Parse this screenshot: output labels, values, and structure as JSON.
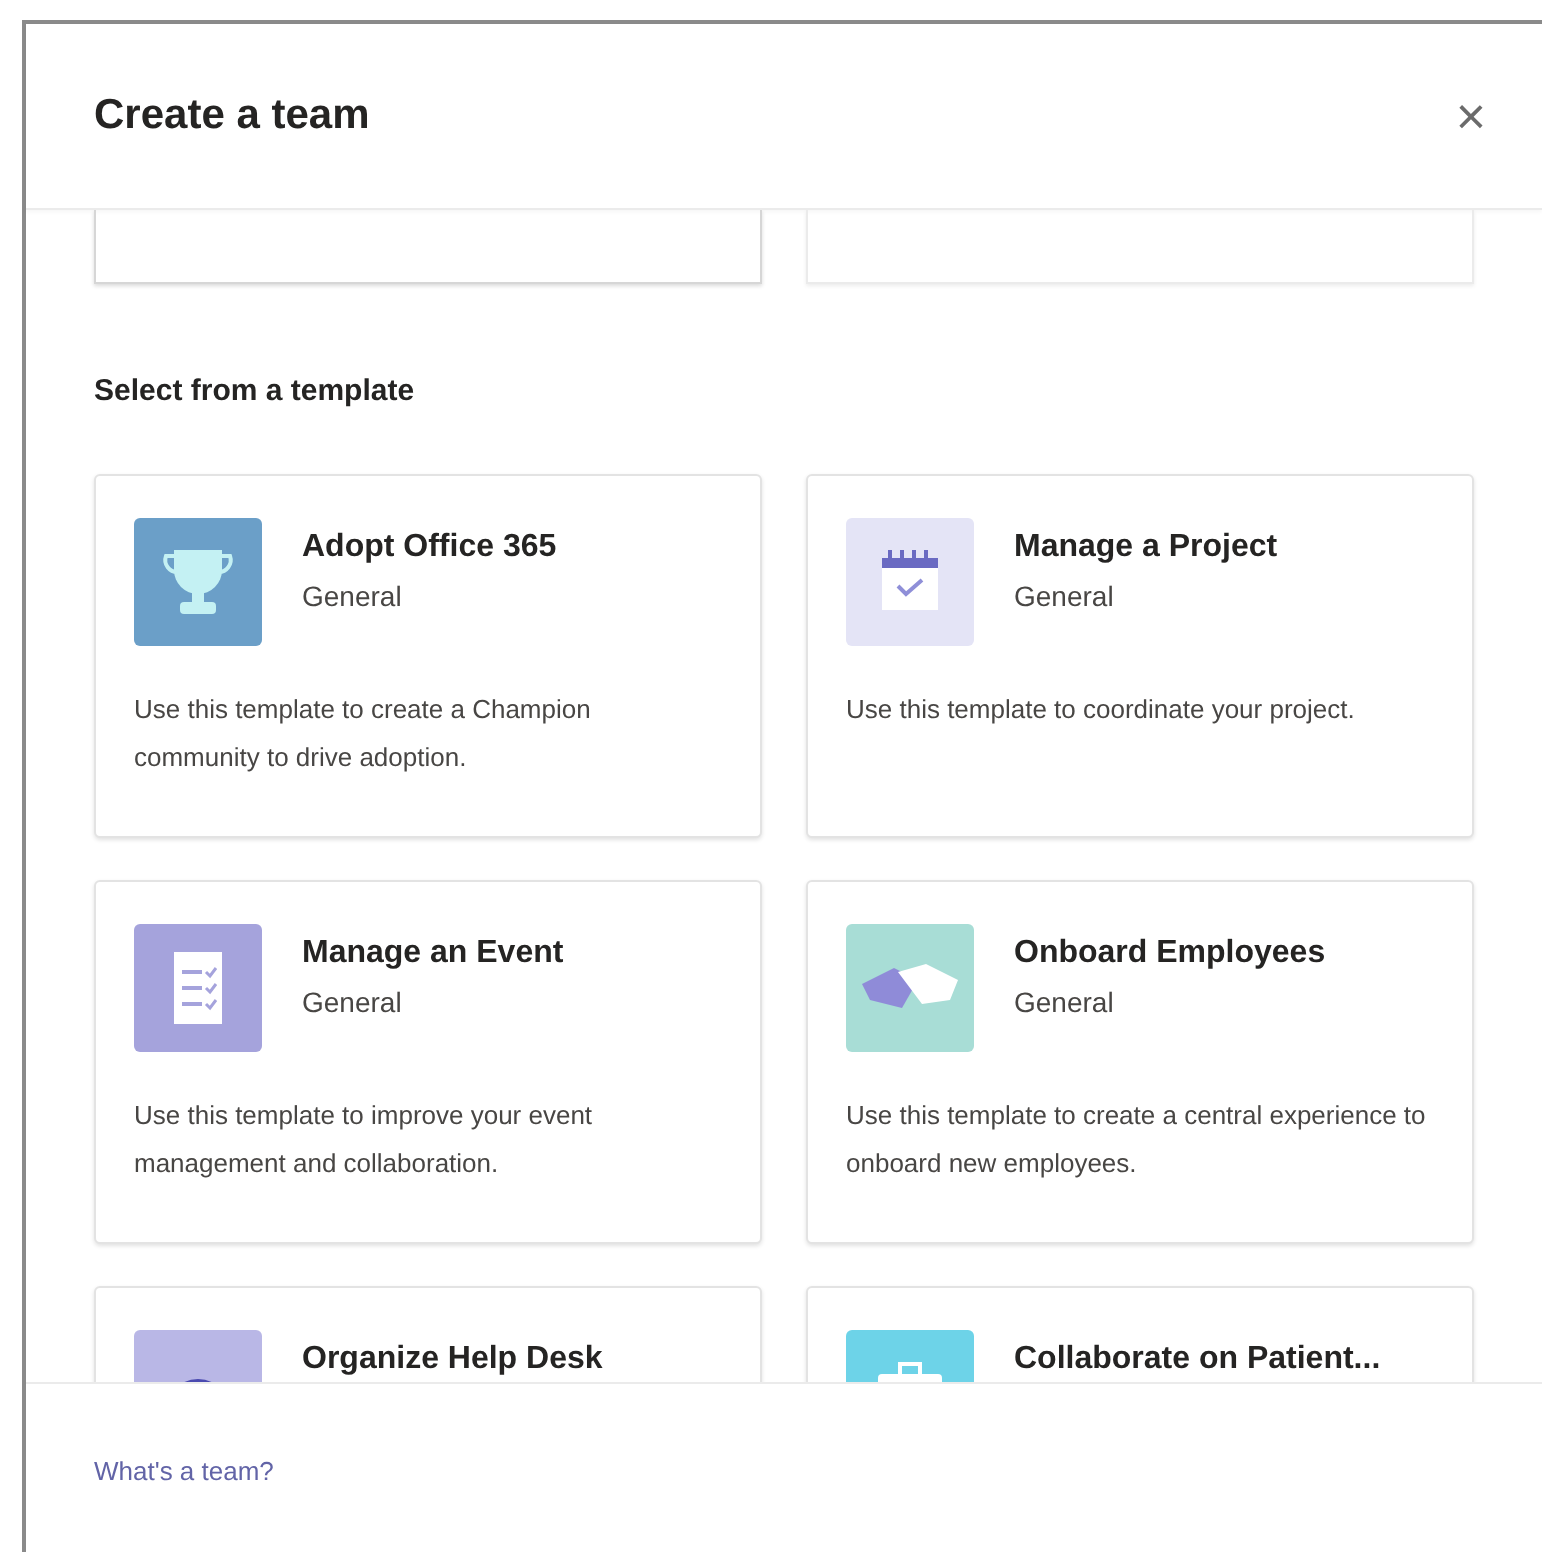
{
  "dialog": {
    "title": "Create a team",
    "close_label": "×"
  },
  "section_label": "Select from a template",
  "templates": [
    {
      "title": "Adopt Office 365",
      "subtitle": "General",
      "description": "Use this template to create a Champion community to drive adoption.",
      "kind": "trophy",
      "color": "#6b9fc8"
    },
    {
      "title": "Manage a Project",
      "subtitle": "General",
      "description": "Use this template to coordinate your project.",
      "kind": "calendar",
      "color": "#e4e4f6"
    },
    {
      "title": "Manage an Event",
      "subtitle": "General",
      "description": "Use this template to improve your event management and collaboration.",
      "kind": "checklist",
      "color": "#a5a3dc"
    },
    {
      "title": "Onboard Employees",
      "subtitle": "General",
      "description": "Use this template to create a central experience to onboard new employees.",
      "kind": "handshake",
      "color": "#a8ddd6"
    },
    {
      "title": "Organize Help Desk",
      "kind": "headset",
      "color": "#b9b7e6"
    },
    {
      "title": "Collaborate on Patient...",
      "kind": "briefcase",
      "color": "#6dd3e8"
    }
  ],
  "footer_link": "What's a team?"
}
